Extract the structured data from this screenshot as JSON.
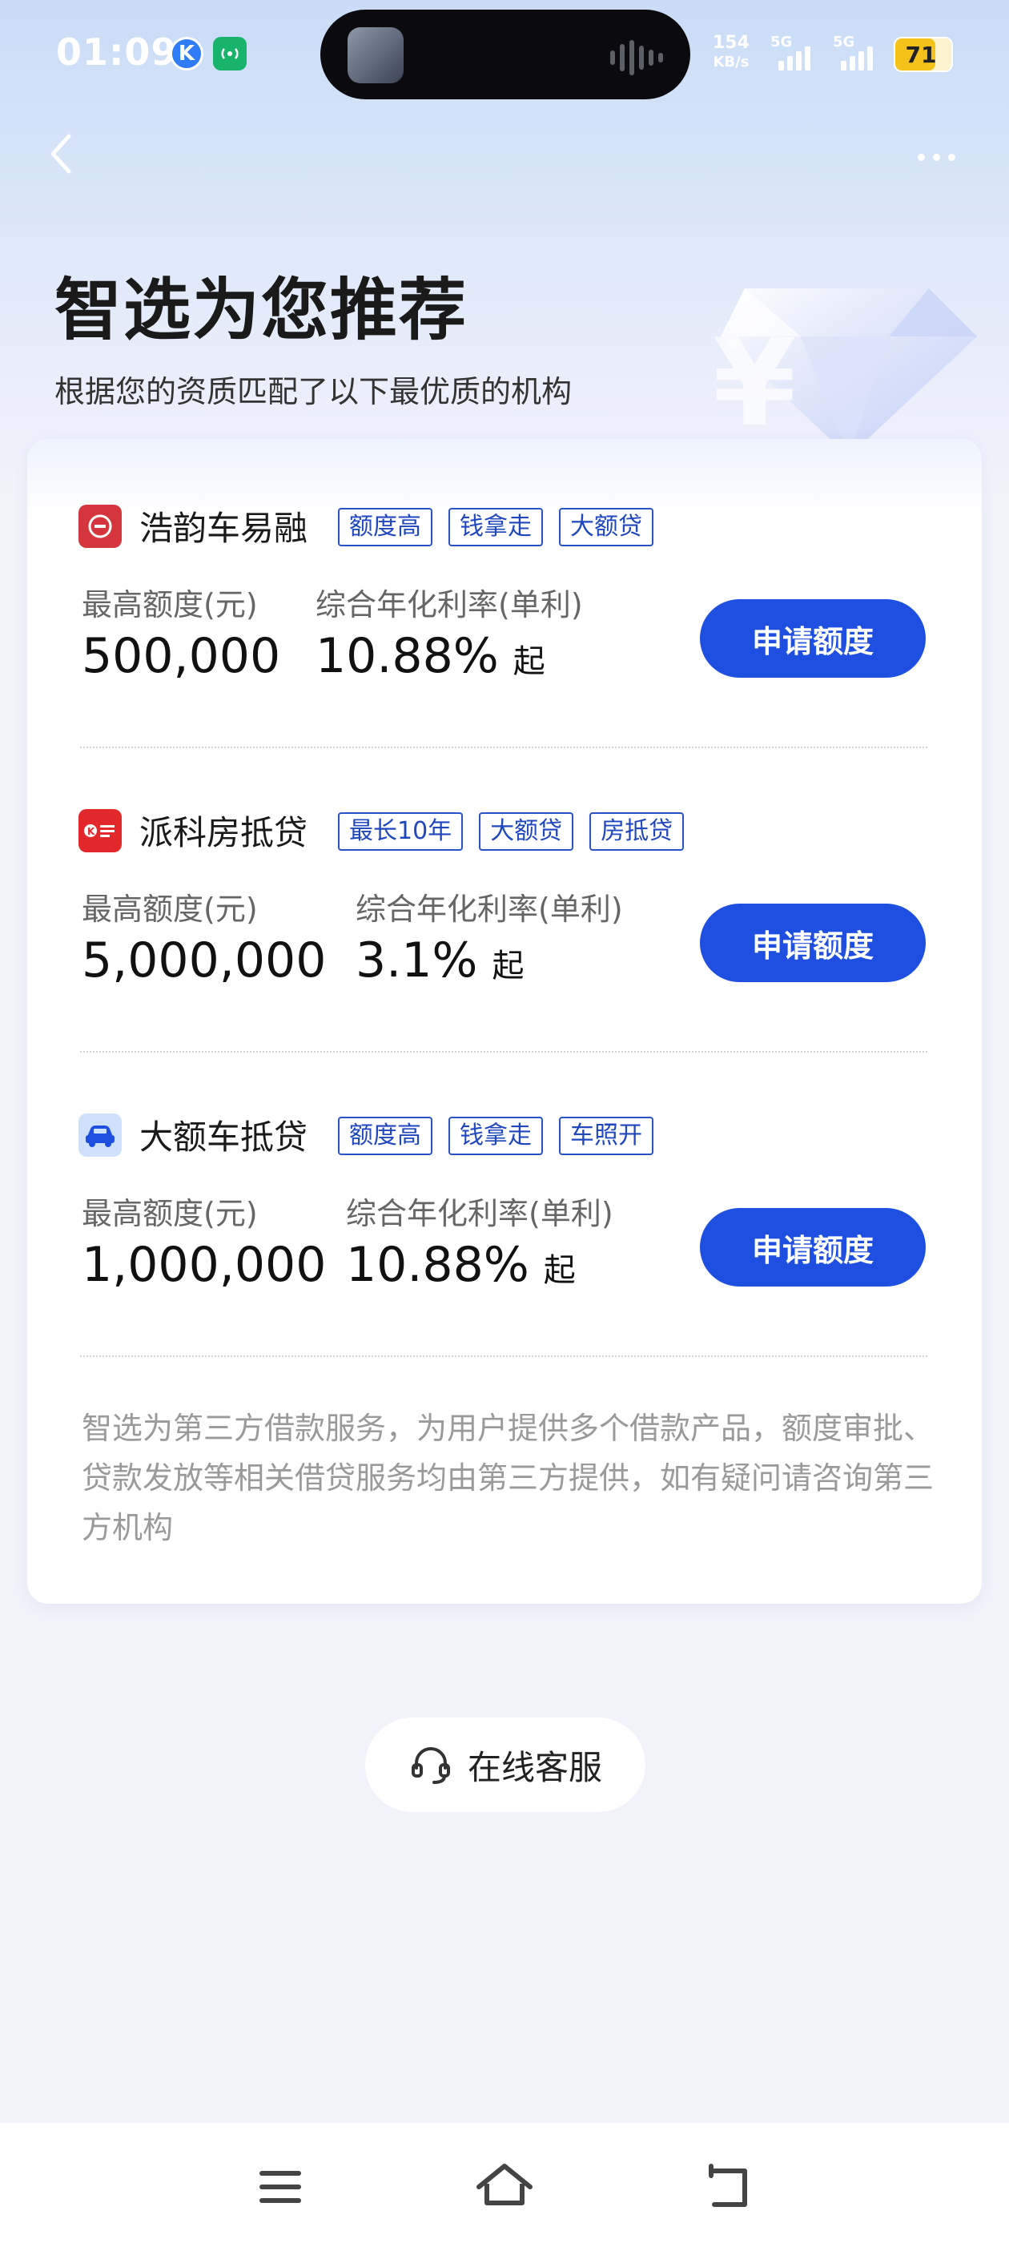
{
  "status_bar": {
    "time": "01:09",
    "k_icon": "K",
    "net_speed_value": "154",
    "net_speed_unit": "KB/s",
    "signal_1_label": "5G",
    "signal_2_label": "5G",
    "battery_level": 71,
    "battery_text": "71"
  },
  "header": {
    "title": "智选为您推荐",
    "subtitle": "根据您的资质匹配了以下最优质的机构"
  },
  "products": [
    {
      "name": "浩韵车易融",
      "logo_color": "#d5363d",
      "tags": [
        "额度高",
        "钱拿走",
        "大额贷"
      ],
      "amount_label": "最高额度(元)",
      "amount_value": "500,000",
      "rate_label": "综合年化利率(单利)",
      "rate_value": "10.88%",
      "rate_suffix": "起",
      "apply_label": "申请额度"
    },
    {
      "name": "派科房抵贷",
      "logo_color": "#e3282c",
      "tags": [
        "最长10年",
        "大额贷",
        "房抵贷"
      ],
      "amount_label": "最高额度(元)",
      "amount_value": "5,000,000",
      "rate_label": "综合年化利率(单利)",
      "rate_value": "3.1%",
      "rate_suffix": "起",
      "apply_label": "申请额度"
    },
    {
      "name": "大额车抵贷",
      "logo_color": "#cfe0fa",
      "tags": [
        "额度高",
        "钱拿走",
        "车照开"
      ],
      "amount_label": "最高额度(元)",
      "amount_value": "1,000,000",
      "rate_label": "综合年化利率(单利)",
      "rate_value": "10.88%",
      "rate_suffix": "起",
      "apply_label": "申请额度"
    }
  ],
  "disclaimer": "智选为第三方借款服务，为用户提供多个借款产品，额度审批、贷款发放等相关借贷服务均由第三方提供，如有疑问请咨询第三方机构",
  "service": {
    "label": "在线客服",
    "icon": "headset-icon"
  },
  "colors": {
    "primary": "#1f4fe0",
    "tag_border": "#2a52c7",
    "background": "#f1f2fa"
  },
  "bottom_nav": {
    "menu_icon": "menu-icon",
    "home_icon": "home-icon",
    "back_icon": "return-icon"
  }
}
